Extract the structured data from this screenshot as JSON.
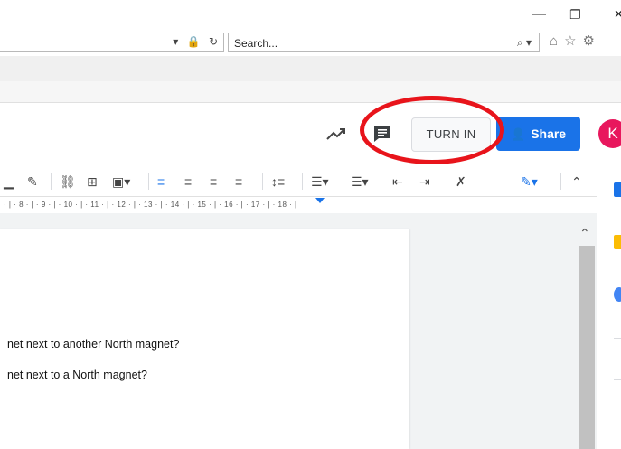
{
  "window": {
    "minimize_glyph": "—",
    "restore_glyph": "❐",
    "close_glyph": "✕"
  },
  "browser": {
    "address_icons": [
      "▾",
      "🔒",
      "↻"
    ],
    "search_placeholder": "Search...",
    "search_icons": [
      "⌕",
      "▾"
    ],
    "toolbar_icons": [
      "home-icon",
      "star-icon",
      "gear-icon"
    ]
  },
  "doc_header": {
    "turn_in_label": "TURN IN",
    "share_label": "Share",
    "avatar_letter": "K"
  },
  "ruler": {
    "text": "· | · 8 · | · 9 · | · 10 · | · 11 · | · 12 · | · 13 · | · 14 · | · 15 · | · 16 · | · 17 · | · 18 · |"
  },
  "document": {
    "lines": [
      "net next to another North magnet?",
      "net next to a North magnet?"
    ]
  },
  "colors": {
    "accent": "#1a73e8",
    "avatar": "#e8175d",
    "highlight": "#e8141b"
  }
}
